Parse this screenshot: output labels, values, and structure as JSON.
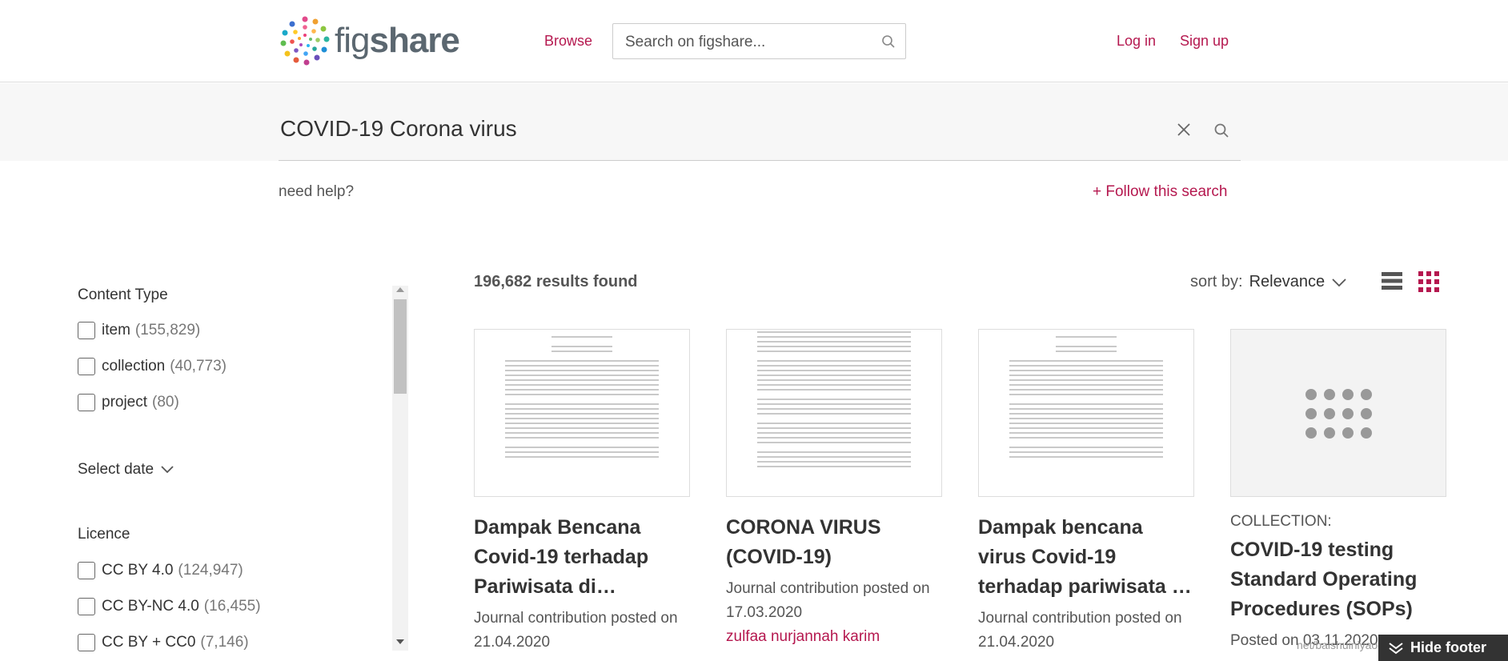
{
  "header": {
    "logo_text_a": "fig",
    "logo_text_b": "share",
    "browse": "Browse",
    "search_placeholder": "Search on figshare...",
    "login": "Log in",
    "signup": "Sign up"
  },
  "search": {
    "query": "COVID-19 Corona virus",
    "help": "need help?",
    "follow": "+  Follow this search"
  },
  "filters": {
    "content_type_title": "Content Type",
    "content_types": [
      {
        "label": "item",
        "count": "(155,829)"
      },
      {
        "label": "collection",
        "count": "(40,773)"
      },
      {
        "label": "project",
        "count": "(80)"
      }
    ],
    "select_date": "Select date",
    "licence_title": "Licence",
    "licences": [
      {
        "label": "CC BY 4.0",
        "count": "(124,947)"
      },
      {
        "label": "CC BY-NC 4.0",
        "count": "(16,455)"
      },
      {
        "label": "CC BY + CC0",
        "count": "(7,146)"
      }
    ]
  },
  "results": {
    "count": "196,682 results found",
    "sort_label": "sort by:",
    "sort_value": "Relevance"
  },
  "cards": [
    {
      "title": "Dampak Bencana Covid-19 terhadap Pariwisata di…",
      "meta": "Journal contribution posted on 21.04.2020",
      "author": ""
    },
    {
      "title": "CORONA VIRUS (COVID-19)",
      "meta": "Journal contribution posted on 17.03.2020",
      "author": "zulfaa nurjannah karim"
    },
    {
      "title": "Dampak bencana virus Covid-19 terhadap pariwisata …",
      "meta": "Journal contribution posted on 21.04.2020",
      "author": ""
    },
    {
      "type": "COLLECTION:",
      "title": "COVID-19 testing Standard Operating Procedures (SOPs)",
      "meta": "Posted on 03.11.2020",
      "author": ""
    }
  ],
  "footer": {
    "hide_footer": "Hide footer",
    "url_overlay": "net/baishuiniyaoqulia"
  },
  "colors": {
    "accent": "#b5184f",
    "text": "#333333",
    "band": "#f7f7f7"
  }
}
